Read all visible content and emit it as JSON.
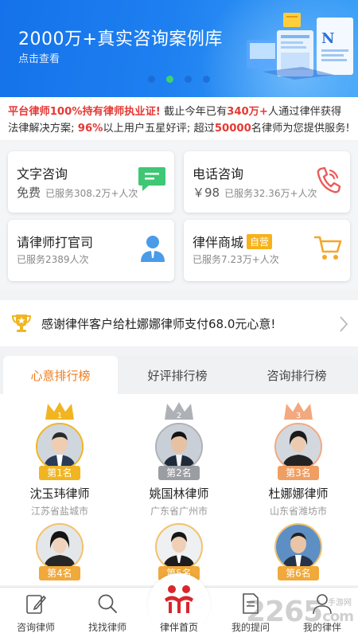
{
  "banner": {
    "title": "2000万+真实咨询案例库",
    "subtitle": "点击查看",
    "active_dot": 1,
    "dot_count": 4
  },
  "notice": {
    "part1": "平台律师100%持有律师执业证!",
    "part2": " 截止今年已有",
    "part3": "340万+",
    "part4": "人通过律伴获得法律解决方案; ",
    "part5": "96%",
    "part6": "以上用户五星好评; 超过",
    "part7": "50000",
    "part8": "名律师为您提供服务!"
  },
  "services": [
    {
      "title": "文字咨询",
      "price": "免费",
      "count": "已服务308.2万+人次",
      "icon": "chat-bubble-icon"
    },
    {
      "title": "电话咨询",
      "price": "￥98",
      "count": "已服务32.36万+人次",
      "icon": "phone-icon"
    },
    {
      "title": "请律师打官司",
      "price": "",
      "count": "已服务2389人次",
      "icon": "lawyer-person-icon"
    },
    {
      "title": "律伴商城",
      "badge": "自营",
      "price": "",
      "count": "已服务7.23万+人次",
      "icon": "shopping-cart-icon"
    }
  ],
  "thanks": {
    "text": "感谢律伴客户给杜娜娜律师支付68.0元心意!",
    "icon": "trophy-icon"
  },
  "tabs": [
    {
      "label": "心意排行榜",
      "active": true
    },
    {
      "label": "好评排行榜",
      "active": false
    },
    {
      "label": "咨询排行榜",
      "active": false
    }
  ],
  "lawyers": [
    {
      "rank": "第1名",
      "name": "沈玉玮律师",
      "location": "江苏省盐城市"
    },
    {
      "rank": "第2名",
      "name": "姚国林律师",
      "location": "广东省广州市"
    },
    {
      "rank": "第3名",
      "name": "杜娜娜律师",
      "location": "山东省潍坊市"
    },
    {
      "rank": "第4名",
      "name": "",
      "location": ""
    },
    {
      "rank": "第5名",
      "name": "",
      "location": ""
    },
    {
      "rank": "第6名",
      "name": "",
      "location": ""
    }
  ],
  "crown_numbers": [
    "1",
    "2",
    "3"
  ],
  "bottom_nav": [
    {
      "label": "咨询律师",
      "icon": "edit-note-icon"
    },
    {
      "label": "找找律师",
      "icon": "search-icon"
    },
    {
      "label": "律伴首页",
      "icon": "home-logo-icon",
      "active": true
    },
    {
      "label": "我的提问",
      "icon": "document-icon"
    },
    {
      "label": "我的律伴",
      "icon": "user-icon"
    }
  ],
  "watermark": {
    "main": "2265",
    "suffix": "com",
    "sub": "手游网"
  },
  "colors": {
    "accent_orange": "#f07b1d",
    "notice_red": "#e53935",
    "banner_blue": "#1d7ff0",
    "gold": "#f1b522",
    "silver": "#9a9da2",
    "bronze": "#ef9f64",
    "nav_red": "#d8262c"
  }
}
